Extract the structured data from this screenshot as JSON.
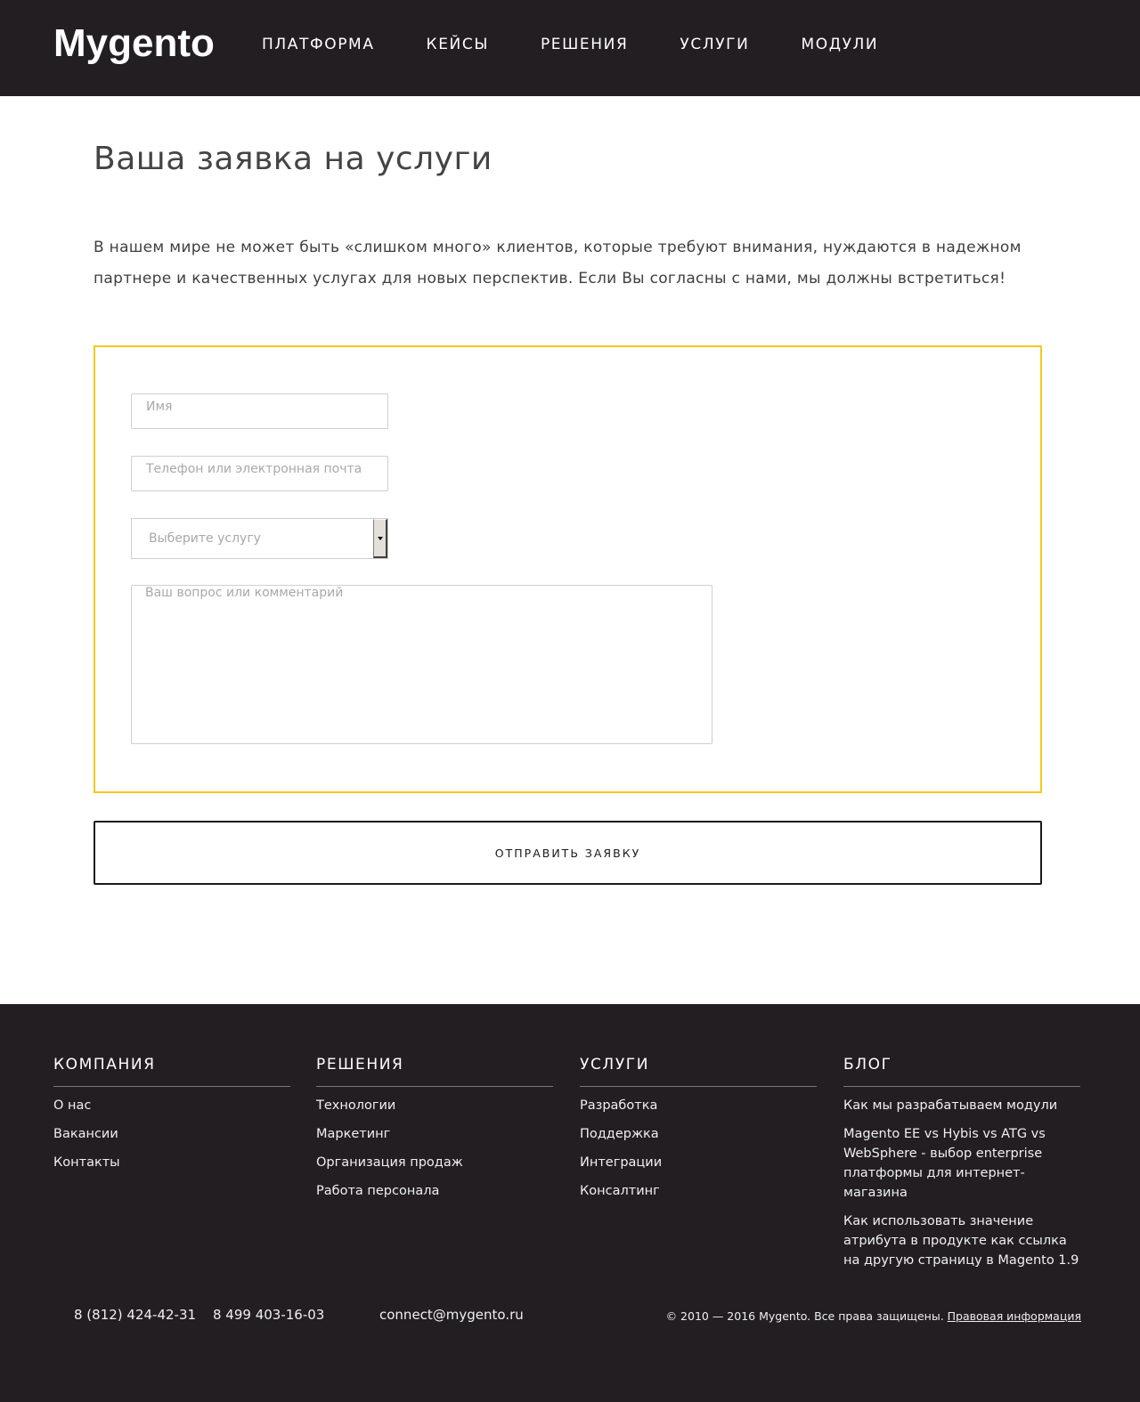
{
  "header": {
    "logo": "Mygento",
    "nav": [
      "ПЛАТФОРМА",
      "КЕЙСЫ",
      "РЕШЕНИЯ",
      "УСЛУГИ",
      "МОДУЛИ"
    ]
  },
  "main": {
    "title": "Ваша заявка на услуги",
    "intro": "В нашем мире не может быть «слишком много» клиентов, которые требуют внимания, нуждаются в надежном партнере и качественных услугах для новых перспектив. Если Вы согласны с нами, мы должны встретиться!"
  },
  "form": {
    "name_placeholder": "Имя",
    "contact_placeholder": "Телефон или электронная почта",
    "service_selected": "Выберите услугу",
    "comment_placeholder": "Ваш вопрос или комментарий",
    "submit_label": "ОТПРАВИТЬ ЗАЯВКУ",
    "border_color": "#f4c91d"
  },
  "footer": {
    "columns": [
      {
        "title": "КОМПАНИЯ",
        "items": [
          "О нас",
          "Вакансии",
          "Контакты"
        ]
      },
      {
        "title": "РЕШЕНИЯ",
        "items": [
          "Технологии",
          "Маркетинг",
          "Организация продаж",
          "Работа персонала"
        ]
      },
      {
        "title": "УСЛУГИ",
        "items": [
          "Разработка",
          "Поддержка",
          "Интеграции",
          "Консалтинг"
        ]
      },
      {
        "title": "БЛОГ",
        "items": [
          "Как мы разрабатываем модули",
          "Magento EE vs Hybis vs ATG vs WebSphere - выбор enterprise платформы для интернет-магазина",
          "Как использовать значение атрибута в продукте как ссылка на другую страницу в Magento 1.9"
        ]
      }
    ],
    "phone1": "8 (812) 424-42-31",
    "phone2": "8 499 403-16-03",
    "email": "connect@mygento.ru",
    "copyright": "© 2010 — 2016 Mygento. Все права защищены.",
    "legal_link": "Правовая информация",
    "bg_color": "#221e22"
  }
}
